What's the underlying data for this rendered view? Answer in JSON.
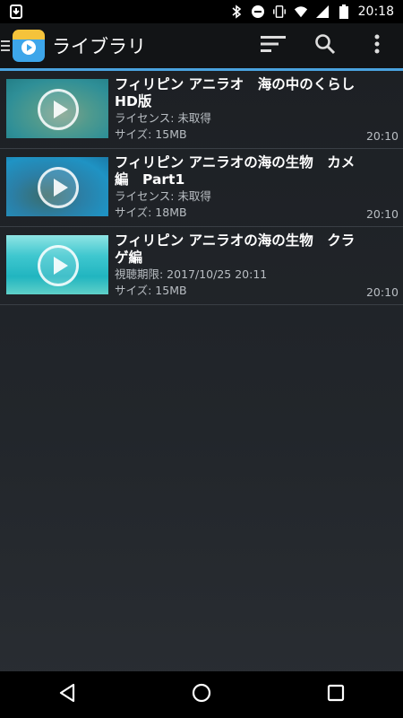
{
  "status_bar": {
    "time": "20:18",
    "icons": [
      "download-icon",
      "bluetooth-icon",
      "dnd-icon",
      "vibrate-icon",
      "wifi-icon",
      "signal-icon",
      "battery-icon"
    ]
  },
  "app_bar": {
    "title": "ライブラリ",
    "actions": [
      "sort-icon",
      "search-icon",
      "more-icon"
    ],
    "accent_color": "#4aa3df"
  },
  "library": [
    {
      "title": "フィリピン アニラオ　海の中のくらし　HD版",
      "status": "ライセンス: 未取得",
      "size": "サイズ: 15MB",
      "time": "20:10"
    },
    {
      "title": "フィリピン アニラオの海の生物　カメ編　Part1",
      "status": "ライセンス: 未取得",
      "size": "サイズ: 18MB",
      "time": "20:10"
    },
    {
      "title": "フィリピン アニラオの海の生物　クラゲ編",
      "status": "視聴期限: 2017/10/25 20:11",
      "size": "サイズ: 15MB",
      "time": "20:10"
    }
  ],
  "nav_bar": {
    "buttons": [
      "back-icon",
      "home-icon",
      "recents-icon"
    ]
  }
}
